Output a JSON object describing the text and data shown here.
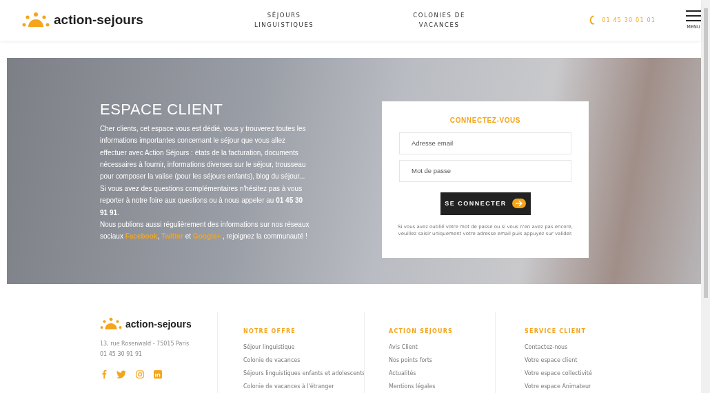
{
  "header": {
    "logo": "action-sejours",
    "nav": [
      {
        "lines": [
          "SÉJOURS",
          "LINGUISTIQUES"
        ]
      },
      {
        "lines": [
          "COLONIES DE",
          "VACANCES"
        ]
      }
    ],
    "phone": "01 45 30 01 01",
    "menu_label": "MENU"
  },
  "hero": {
    "title": "ESPACE CLIENT",
    "intro": "Cher clients, cet espace vous est dédié, vous y trouverez toutes les informations importantes concernant le séjour que vous allez effectuer avec Action Séjours : états de la facturation, documents nécessaires à fournir, informations diverses sur le séjour, trousseau pour composer la valise (pour les séjours enfants), blog du séjour... Si vous avez des questions complémentaires n'hésitez pas à vous reporter à notre foire aux questions ou à nous appeler au **01 45 30 91 91**.",
    "social_text": [
      {
        "kind": "text",
        "text": "Nous publions aussi régulièrement des informations sur nos réseaux sociaux "
      },
      {
        "kind": "link",
        "text": "Facebook"
      },
      {
        "kind": "text",
        "text": ", "
      },
      {
        "kind": "link",
        "text": "Twitter"
      },
      {
        "kind": "text",
        "text": " et "
      },
      {
        "kind": "link",
        "text": "Google+"
      },
      {
        "kind": "text",
        "text": " , rejoignez la communauté !"
      }
    ]
  },
  "login": {
    "title": "CONNECTEZ-VOUS",
    "email_placeholder": "Adresse email",
    "password_placeholder": "Mot de passe",
    "button": "SE CONNECTER",
    "note": "Si vous avez oublié votre mot de passe ou si vous n'en avez pas encore, veuillez saisir uniquement votre adresse email puis appuyez sur valider."
  },
  "footer": {
    "logo": "action-sejours",
    "address": "13, rue Rosenwald - 75015 Paris",
    "phone": "01 45 30 91 91",
    "social": [
      {
        "kind": "facebook"
      },
      {
        "kind": "twitter"
      },
      {
        "kind": "instagram"
      },
      {
        "kind": "linkedin"
      }
    ],
    "columns": [
      {
        "title": "NOTRE OFFRE",
        "links": [
          "Séjour linguistique",
          "Colonie de vacances",
          "Séjours linguistiques enfants et adolescents",
          "Colonie de vacances à l'étranger"
        ]
      },
      {
        "title": "ACTION SÉJOURS",
        "links": [
          "Avis Client",
          "Nos points forts",
          "Actualités",
          "Mentions légales"
        ]
      },
      {
        "title": "SERVICE CLIENT",
        "links": [
          "Contactez-nous",
          "Votre espace client",
          "Votre espace collectivité",
          "Votre espace Animateur"
        ]
      }
    ]
  }
}
